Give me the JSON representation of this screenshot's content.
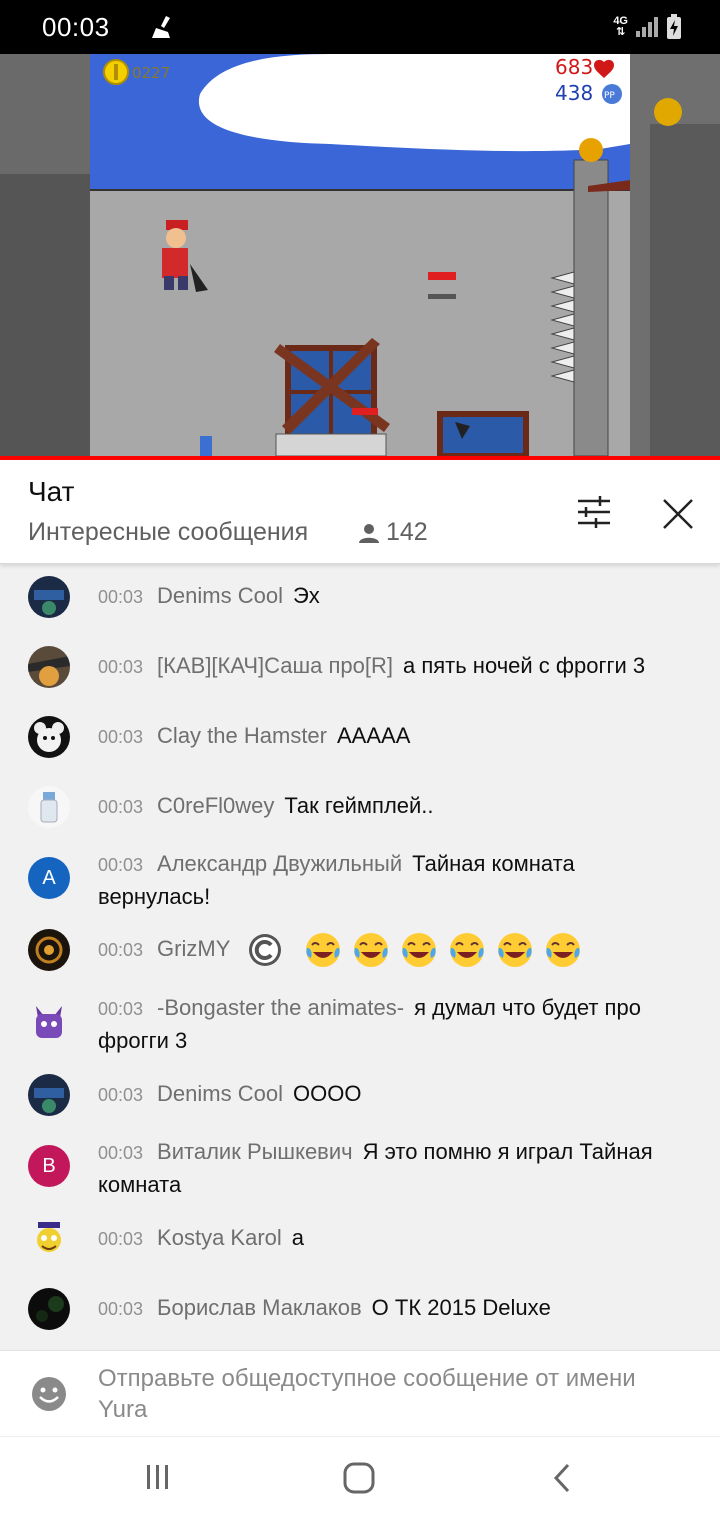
{
  "status_bar": {
    "time": "00:03",
    "network": "4G"
  },
  "game": {
    "coins": "0227",
    "health": "683",
    "points": "438",
    "points_badge": "PP"
  },
  "chat": {
    "title": "Чат",
    "mode": "Интересные сообщения",
    "viewers": "142"
  },
  "messages": [
    {
      "time": "00:03",
      "author": "Denims Cool",
      "text": "Эх"
    },
    {
      "time": "00:03",
      "author": "[КАВ][КАЧ]Саша про[R]",
      "text": "а пять ночей с фрогги 3"
    },
    {
      "time": "00:03",
      "author": "Clay the Hamster",
      "text": "AAAAA"
    },
    {
      "time": "00:03",
      "author": "C0reFl0wey",
      "text": "Так геймплей.."
    },
    {
      "time": "00:03",
      "author": "Александр Двужильный",
      "text": "Тайная комната вернулась!",
      "avatar_letter": "A",
      "avatar_color": "#1565c0"
    },
    {
      "time": "00:03",
      "author": "GrizMY",
      "text": ""
    },
    {
      "time": "00:03",
      "author": "-Bongaster the animates-",
      "text": "я думал что будет про фрогги 3"
    },
    {
      "time": "00:03",
      "author": "Denims Cool",
      "text": "OOOO"
    },
    {
      "time": "00:03",
      "author": "Виталик Рышкевич",
      "text": "Я это помню я играл Тайная комната",
      "avatar_letter": "B",
      "avatar_color": "#c2185b"
    },
    {
      "time": "00:03",
      "author": "Kostya Karol",
      "text": "а"
    },
    {
      "time": "00:03",
      "author": "Борислав Маклаков",
      "text": "О ТК 2015 Deluxe"
    }
  ],
  "input": {
    "placeholder": "Отправьте общедоступное сообщение от имени Yura"
  },
  "colors": {
    "progress": "#ff0000",
    "chat_bg": "#f1f1f1",
    "sky": "#3a66d8"
  }
}
